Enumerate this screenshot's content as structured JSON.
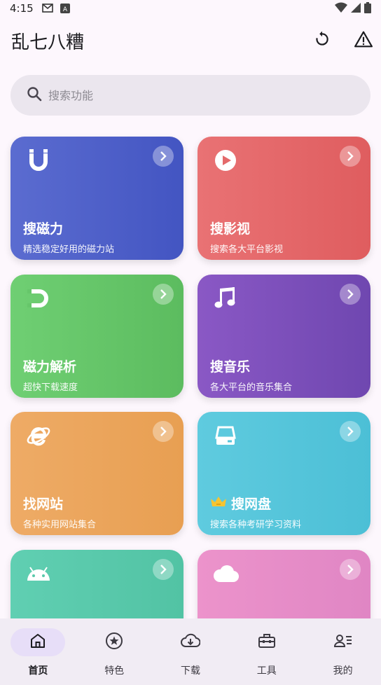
{
  "status_bar": {
    "time": "4:15"
  },
  "app_bar": {
    "title": "乱七八糟"
  },
  "search": {
    "placeholder": "搜索功能"
  },
  "cards": [
    {
      "title": "搜磁力",
      "subtitle": "精选稳定好用的磁力站",
      "icon": "magnet-u-icon",
      "color": "#4f62c9"
    },
    {
      "title": "搜影视",
      "subtitle": "搜索各大平台影视",
      "icon": "play-circle-icon",
      "color": "#e46a6b"
    },
    {
      "title": "磁力解析",
      "subtitle": "超快下载速度",
      "icon": "magnet-d-icon",
      "color": "#66c66a"
    },
    {
      "title": "搜音乐",
      "subtitle": "各大平台的音乐集合",
      "icon": "music-note-icon",
      "color": "#7c50bb"
    },
    {
      "title": "找网站",
      "subtitle": "各种实用网站集合",
      "icon": "internet-explorer-icon",
      "color": "#eba55c"
    },
    {
      "title": "搜网盘",
      "subtitle": "搜索各种考研学习资料",
      "icon": "hard-drive-icon",
      "color": "#56c5db",
      "badge_icon": "crown-icon"
    },
    {
      "title": "",
      "subtitle": "",
      "icon": "android-icon",
      "color": "#5ac9ab"
    },
    {
      "title": "",
      "subtitle": "",
      "icon": "cloud-icon",
      "color": "#e68cc7"
    }
  ],
  "bottom_nav": [
    {
      "label": "首页",
      "icon": "home-icon",
      "active": true
    },
    {
      "label": "特色",
      "icon": "star-circle-icon"
    },
    {
      "label": "下载",
      "icon": "cloud-download-icon"
    },
    {
      "label": "工具",
      "icon": "toolbox-icon"
    },
    {
      "label": "我的",
      "icon": "person-list-icon"
    }
  ]
}
